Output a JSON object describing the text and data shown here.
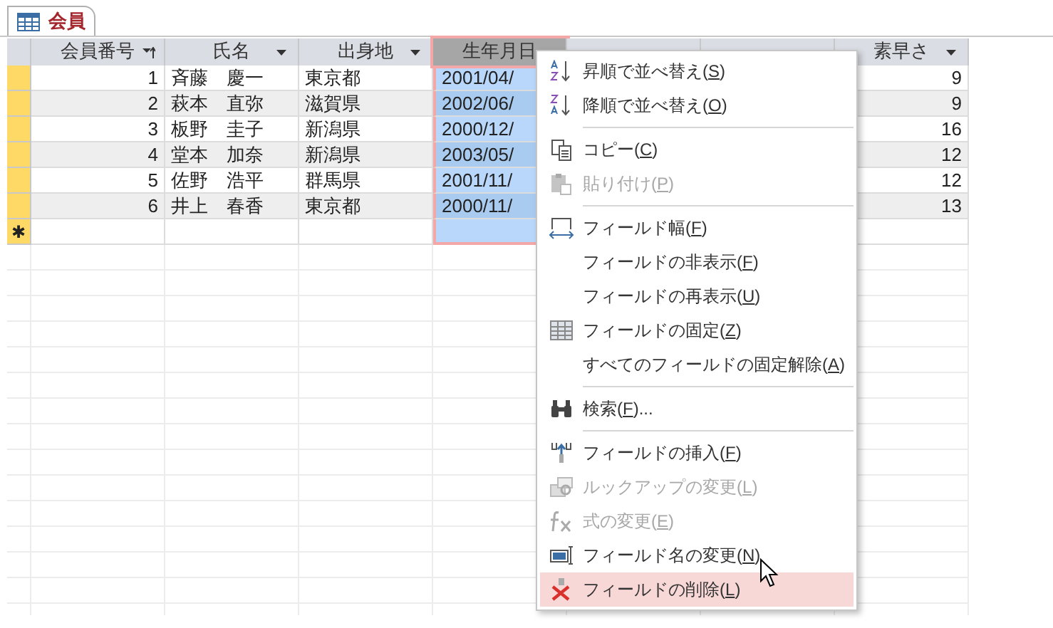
{
  "tab": {
    "label": "会員",
    "selected": true
  },
  "columns": [
    {
      "label": "会員番号",
      "sorted": true,
      "selected": false
    },
    {
      "label": "氏名",
      "sorted": false,
      "selected": false
    },
    {
      "label": "出身地",
      "sorted": false,
      "selected": false
    },
    {
      "label": "生年月日",
      "selected": true
    },
    {
      "selected": false
    },
    {
      "selected": false
    },
    {
      "label": "素早さ",
      "sorted": false,
      "selected": false
    }
  ],
  "rows": [
    {
      "cells": [
        "1",
        "斉藤　慶一",
        "東京都",
        "2001/04/",
        "",
        "",
        "9"
      ]
    },
    {
      "cells": [
        "2",
        "萩本　直弥",
        "滋賀県",
        "2002/06/",
        "",
        "",
        "9"
      ]
    },
    {
      "cells": [
        "3",
        "板野　圭子",
        "新潟県",
        "2000/12/",
        "",
        "",
        "16"
      ]
    },
    {
      "cells": [
        "4",
        "堂本　加奈",
        "新潟県",
        "2003/05/",
        "",
        "",
        "12"
      ]
    },
    {
      "cells": [
        "5",
        "佐野　浩平",
        "群馬県",
        "2001/11/",
        "",
        "",
        "12"
      ]
    },
    {
      "cells": [
        "6",
        "井上　春香",
        "東京都",
        "2000/11/",
        "",
        "",
        "13"
      ]
    }
  ],
  "new_row_marker": "✱",
  "context_menu": [
    {
      "kind": "item",
      "before": "昇順で並べ替え(",
      "key": "S",
      "after": ")",
      "disabled": false,
      "hovered": false
    },
    {
      "kind": "item",
      "before": "降順で並べ替え(",
      "key": "O",
      "after": ")",
      "disabled": false,
      "hovered": false
    },
    {
      "kind": "separator"
    },
    {
      "kind": "item",
      "before": "コピー(",
      "key": "C",
      "after": ")",
      "disabled": false,
      "hovered": false
    },
    {
      "kind": "item",
      "before": "貼り付け(",
      "key": "P",
      "after": ")",
      "disabled": true,
      "hovered": false
    },
    {
      "kind": "separator"
    },
    {
      "kind": "item",
      "before": "フィールド幅(",
      "key": "F",
      "after": ")",
      "disabled": false,
      "hovered": false
    },
    {
      "kind": "item",
      "before": "フィールドの非表示(",
      "key": "F",
      "after": ")",
      "disabled": false,
      "hovered": false
    },
    {
      "kind": "item",
      "before": "フィールドの再表示(",
      "key": "U",
      "after": ")",
      "disabled": false,
      "hovered": false
    },
    {
      "kind": "item",
      "before": "フィールドの固定(",
      "key": "Z",
      "after": ")",
      "disabled": false,
      "hovered": false
    },
    {
      "kind": "item",
      "before": "すべてのフィールドの固定解除(",
      "key": "A",
      "after": ")",
      "disabled": false,
      "hovered": false
    },
    {
      "kind": "separator"
    },
    {
      "kind": "item",
      "before": "検索(",
      "key": "F",
      "after": ")...",
      "disabled": false,
      "hovered": false
    },
    {
      "kind": "separator"
    },
    {
      "kind": "item",
      "before": "フィールドの挿入(",
      "key": "F",
      "after": ")",
      "disabled": false,
      "hovered": false
    },
    {
      "kind": "item",
      "before": "ルックアップの変更(",
      "key": "L",
      "after": ")",
      "disabled": true,
      "hovered": false
    },
    {
      "kind": "item",
      "before": "式の変更(",
      "key": "E",
      "after": ")",
      "disabled": true,
      "hovered": false
    },
    {
      "kind": "item",
      "before": "フィールド名の変更(",
      "key": "N",
      "after": ")",
      "disabled": false,
      "hovered": false
    },
    {
      "kind": "item",
      "before": "フィールドの削除(",
      "key": "L",
      "after": ")",
      "disabled": false,
      "hovered": true
    }
  ]
}
